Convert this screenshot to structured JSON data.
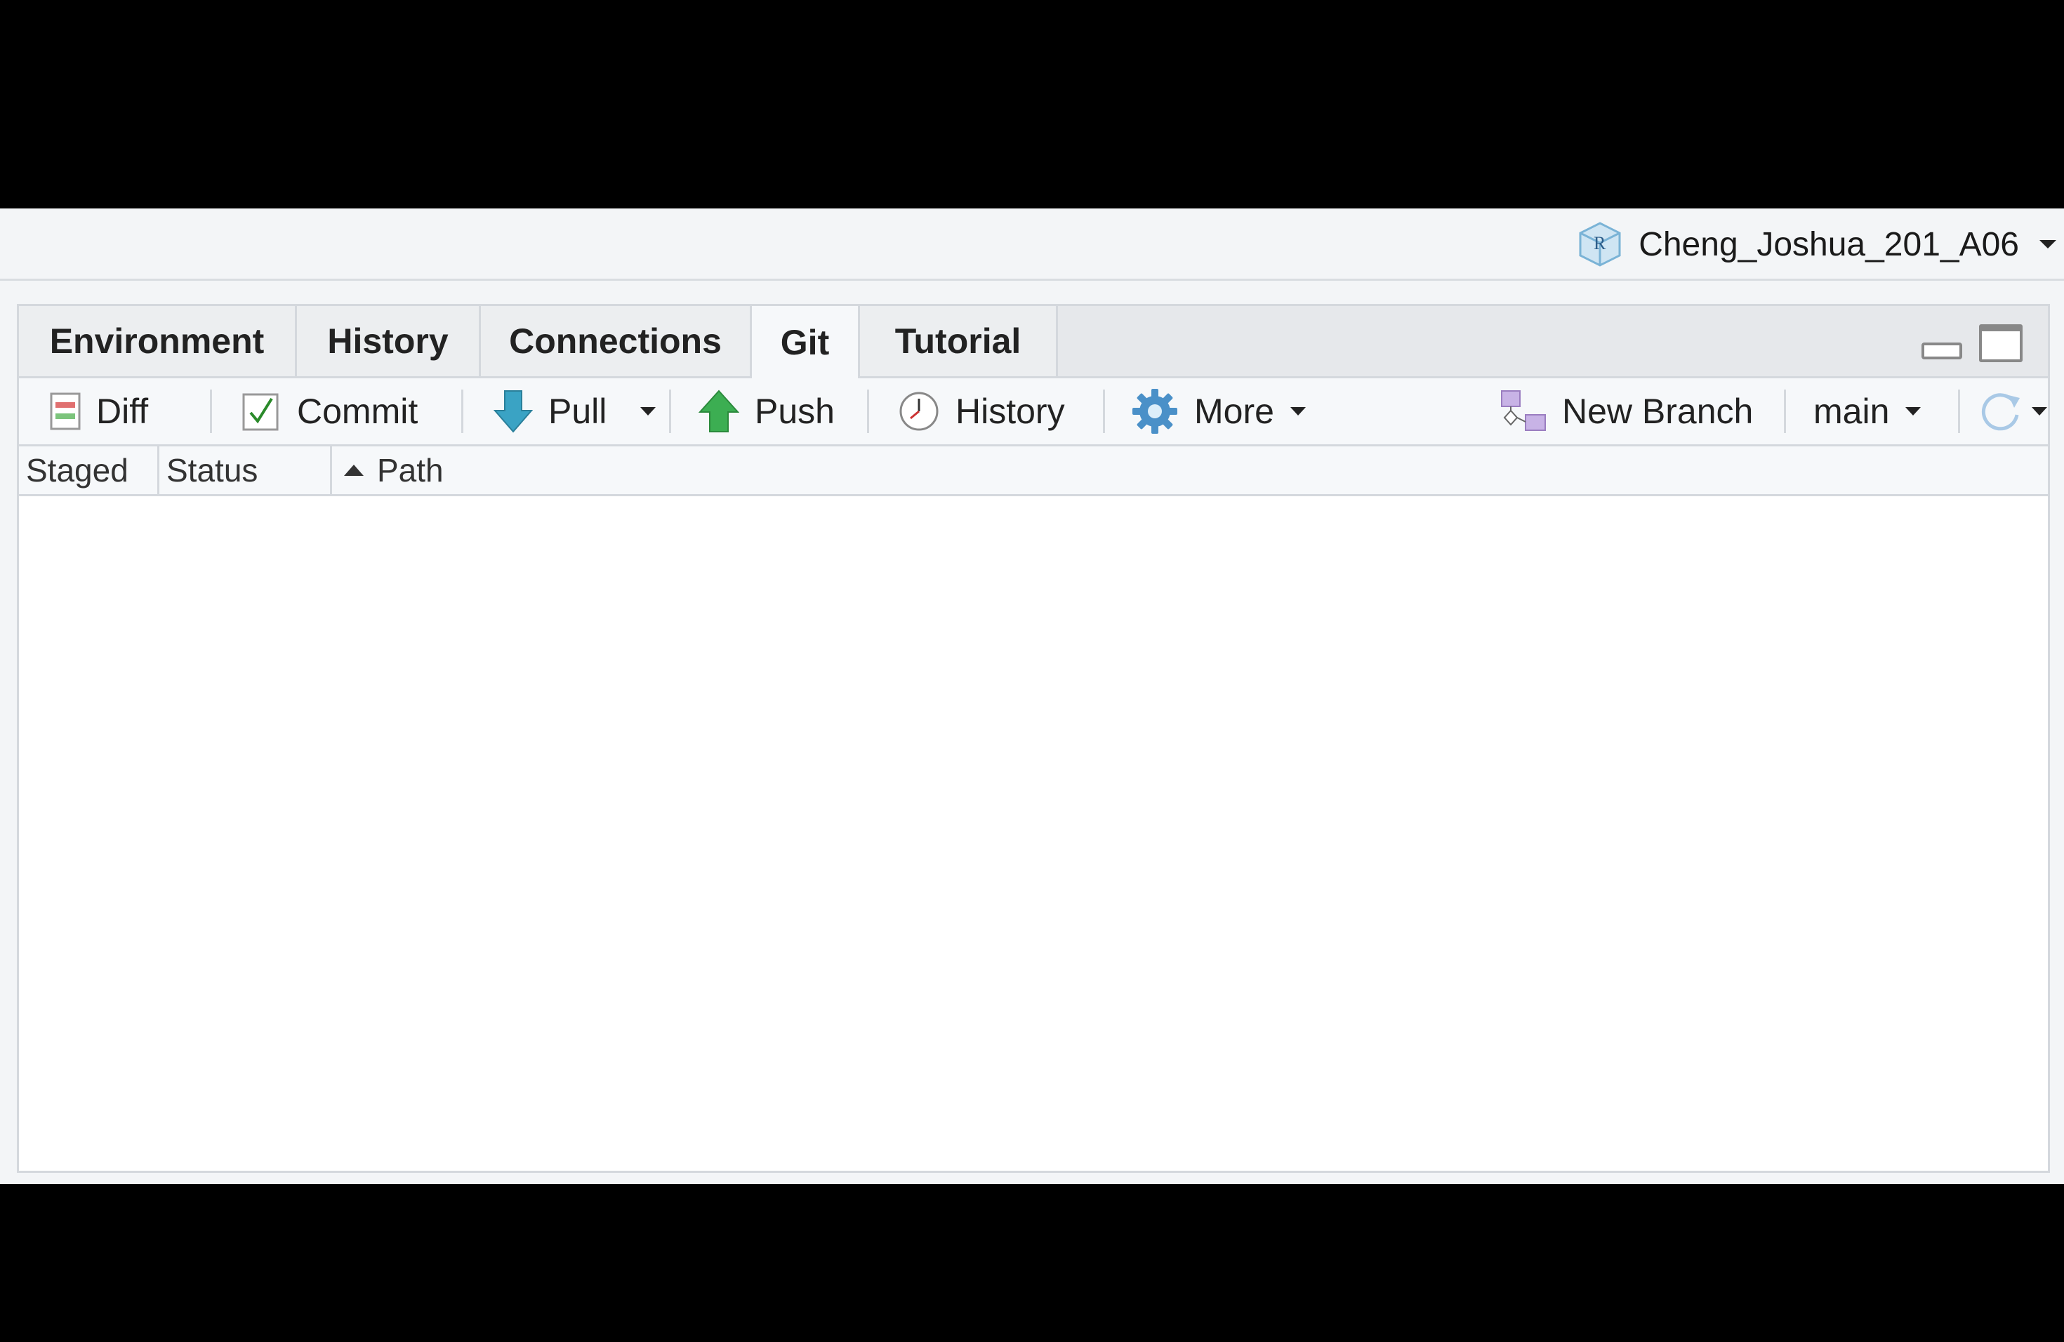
{
  "project": {
    "name": "Cheng_Joshua_201_A06",
    "icon": "r-project-cube-icon"
  },
  "tabs": [
    {
      "label": "Environment",
      "active": false
    },
    {
      "label": "History",
      "active": false
    },
    {
      "label": "Connections",
      "active": false
    },
    {
      "label": "Git",
      "active": true
    },
    {
      "label": "Tutorial",
      "active": false
    }
  ],
  "toolbar": {
    "diff": "Diff",
    "commit": "Commit",
    "pull": "Pull",
    "push": "Push",
    "history": "History",
    "more": "More",
    "new_branch": "New Branch",
    "branch": "main"
  },
  "columns": {
    "staged": "Staged",
    "status": "Status",
    "path": "Path",
    "sort_indicator": "ascending"
  },
  "files": [],
  "colors": {
    "pull_arrow": "#3aa3c4",
    "push_arrow": "#3cae52",
    "gear": "#4a90c8",
    "branch_icon": "#b79ad6",
    "commit_check": "#2a8a2a",
    "diff_red": "#e07070",
    "diff_green": "#7cc47c"
  }
}
